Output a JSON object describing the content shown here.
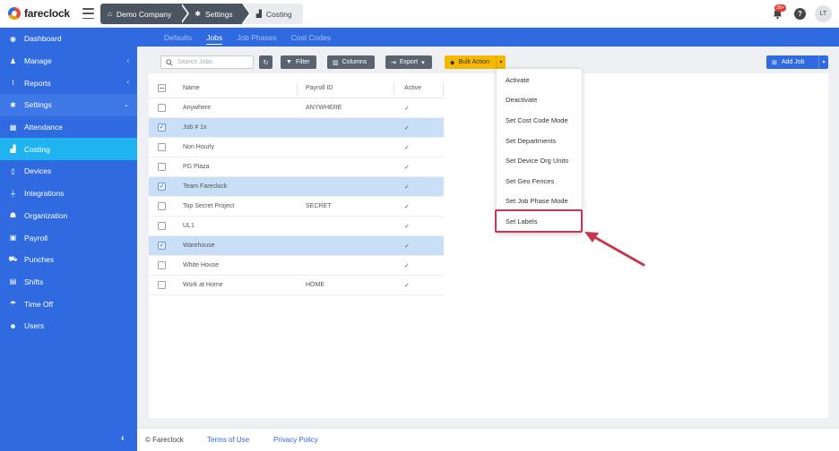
{
  "app": {
    "name": "fareclock"
  },
  "breadcrumbs": [
    {
      "label": "Demo Company",
      "icon": "home-icon"
    },
    {
      "label": "Settings",
      "icon": "gear-icon"
    },
    {
      "label": "Costing",
      "icon": "factory-icon"
    }
  ],
  "header": {
    "notifications": "28+",
    "help": "?",
    "avatar": "LT"
  },
  "sidebar": {
    "items": [
      {
        "label": "Dashboard",
        "icon": "dashboard-icon"
      },
      {
        "label": "Manage",
        "icon": "person-icon"
      },
      {
        "label": "Reports",
        "icon": "chart-icon"
      },
      {
        "label": "Settings",
        "icon": "gear-icon"
      },
      {
        "label": "Attendance",
        "icon": "attendance-icon"
      },
      {
        "label": "Costing",
        "icon": "factory-icon"
      },
      {
        "label": "Devices",
        "icon": "tablet-icon"
      },
      {
        "label": "Integrations",
        "icon": "plug-icon"
      },
      {
        "label": "Organization",
        "icon": "org-icon"
      },
      {
        "label": "Payroll",
        "icon": "money-icon"
      },
      {
        "label": "Punches",
        "icon": "truck-icon"
      },
      {
        "label": "Shifts",
        "icon": "clipboard-icon"
      },
      {
        "label": "Time Off",
        "icon": "beach-icon"
      },
      {
        "label": "Users",
        "icon": "users-icon"
      }
    ],
    "collapse": "‹"
  },
  "subtabs": [
    "Defaults",
    "Jobs",
    "Job Phases",
    "Cost Codes"
  ],
  "toolbar": {
    "search_placeholder": "Search Jobs",
    "filter": "Filter",
    "columns": "Columns",
    "export": "Export",
    "bulk_action": "Bulk Action",
    "add_job": "Add Job"
  },
  "table": {
    "headers": {
      "name": "Name",
      "payroll_id": "Payroll ID",
      "active": "Active"
    },
    "rows": [
      {
        "name": "Anywhere",
        "payroll_id": "ANYWHERE",
        "active": "✓",
        "selected": false
      },
      {
        "name": "Job # 1x",
        "payroll_id": "",
        "active": "✓",
        "selected": true
      },
      {
        "name": "Non Hourly",
        "payroll_id": "",
        "active": "✓",
        "selected": false
      },
      {
        "name": "PG Plaza",
        "payroll_id": "",
        "active": "✓",
        "selected": false
      },
      {
        "name": "Team Fareclock",
        "payroll_id": "",
        "active": "✓",
        "selected": true
      },
      {
        "name": "Top Secret Project",
        "payroll_id": "SECRET",
        "active": "✓",
        "selected": false
      },
      {
        "name": "UL1",
        "payroll_id": "",
        "active": "✓",
        "selected": false
      },
      {
        "name": "Warehouse",
        "payroll_id": "",
        "active": "✓",
        "selected": true
      },
      {
        "name": "White House",
        "payroll_id": "",
        "active": "✓",
        "selected": false
      },
      {
        "name": "Work at Home",
        "payroll_id": "HOME",
        "active": "✓",
        "selected": false
      }
    ]
  },
  "bulk_menu": {
    "items": [
      "Activate",
      "Deactivate",
      "Set Cost Code Mode",
      "Set Departments",
      "Set Device Org Units",
      "Set Geo Fences",
      "Set Job Phase Mode",
      "Set Labels"
    ],
    "highlighted": "Set Labels"
  },
  "footer": {
    "copyright": "© Fareclock",
    "terms": "Terms of Use",
    "privacy": "Privacy Policy"
  },
  "colors": {
    "primary": "#2f6ae1",
    "active_nav": "#1fb4ef",
    "bulk": "#f5b800",
    "selected_row": "#c8dff7",
    "highlight_box": "#c4374f"
  }
}
